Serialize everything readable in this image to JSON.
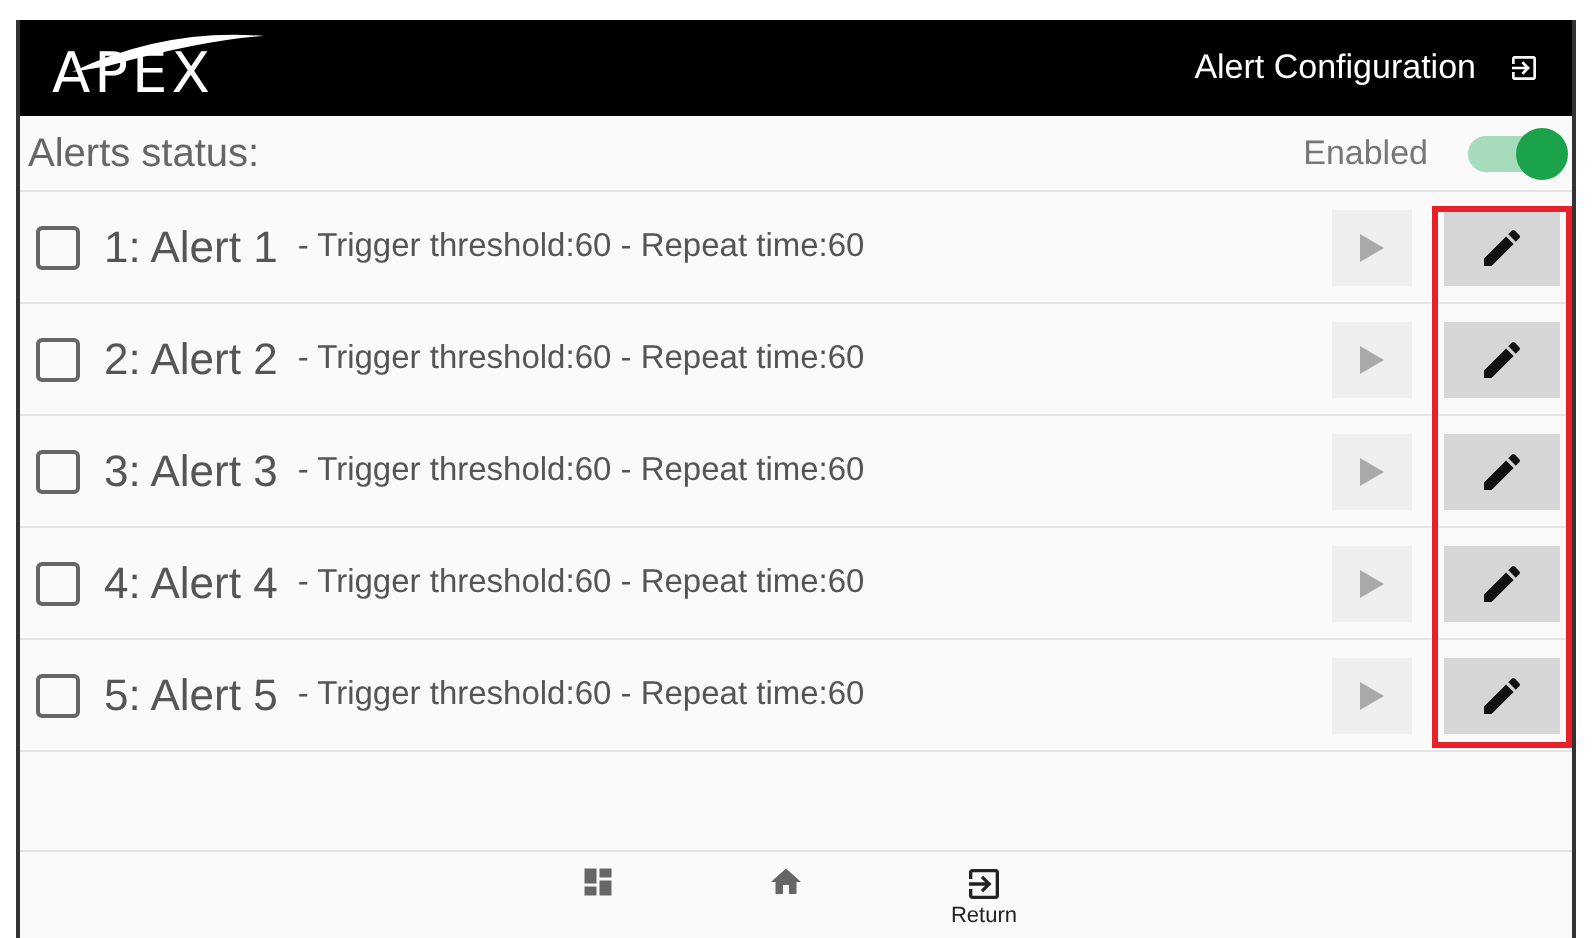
{
  "header": {
    "logo": "APEX",
    "title": "Alert Configuration"
  },
  "status": {
    "label": "Alerts status:",
    "state_label": "Enabled",
    "on": true
  },
  "alerts": [
    {
      "name": "1: Alert 1",
      "details": "- Trigger threshold:60 - Repeat time:60",
      "checked": false
    },
    {
      "name": "2: Alert 2",
      "details": "- Trigger threshold:60 - Repeat time:60",
      "checked": false
    },
    {
      "name": "3: Alert 3",
      "details": "- Trigger threshold:60 - Repeat time:60",
      "checked": false
    },
    {
      "name": "4: Alert 4",
      "details": "- Trigger threshold:60 - Repeat time:60",
      "checked": false
    },
    {
      "name": "5: Alert 5",
      "details": "- Trigger threshold:60 - Repeat time:60",
      "checked": false
    }
  ],
  "nav": [
    {
      "kind": "dashboard",
      "selected": false
    },
    {
      "kind": "home",
      "selected": false
    },
    {
      "kind": "return",
      "label": "Return",
      "selected": true
    }
  ]
}
